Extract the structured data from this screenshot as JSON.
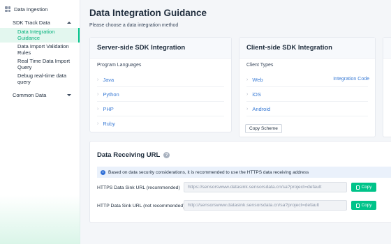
{
  "sidebar": {
    "header": "Data Ingestion",
    "group_sdk": "SDK Track Data",
    "items": [
      {
        "label": "Data Integration Guidance"
      },
      {
        "label": "Data Import Validation Rules"
      },
      {
        "label": "Real Time Data Import Query"
      },
      {
        "label": "Debug real-time data query"
      }
    ],
    "group_common": "Common Data"
  },
  "main": {
    "title": "Data Integration Guidance",
    "subtitle": "Please choose a data integration method"
  },
  "server_card": {
    "title": "Server-side SDK Integration",
    "section_label": "Program Languages",
    "languages": [
      "Java",
      "Python",
      "PHP",
      "Ruby"
    ]
  },
  "client_card": {
    "title": "Client-side SDK Integration",
    "section_label": "Client Types",
    "types": [
      "Web",
      "iOS",
      "Android"
    ],
    "integration_code_link": "Integration Code",
    "copy_scheme_label": "Copy Scheme"
  },
  "receiving": {
    "title": "Data Receiving URL",
    "help_icon_text": "?",
    "notice": "Based on data security considerations, it is recommended to use the HTTPS data receiving address",
    "https_label": "HTTPS Data Sink URL (recommended)",
    "https_url": "https://sensorswww.datasink.sensorsdata.cn/sa?project=default",
    "http_label": "HTTP Data Sink URL (not recommended)",
    "http_url": "http://sensorswww.datasink.sensorsdata.cn/sa?project=default",
    "copy_label": "Copy"
  },
  "colors": {
    "accent": "#00c389",
    "link": "#3a7bd5",
    "active_bg": "#e3f7ef"
  }
}
